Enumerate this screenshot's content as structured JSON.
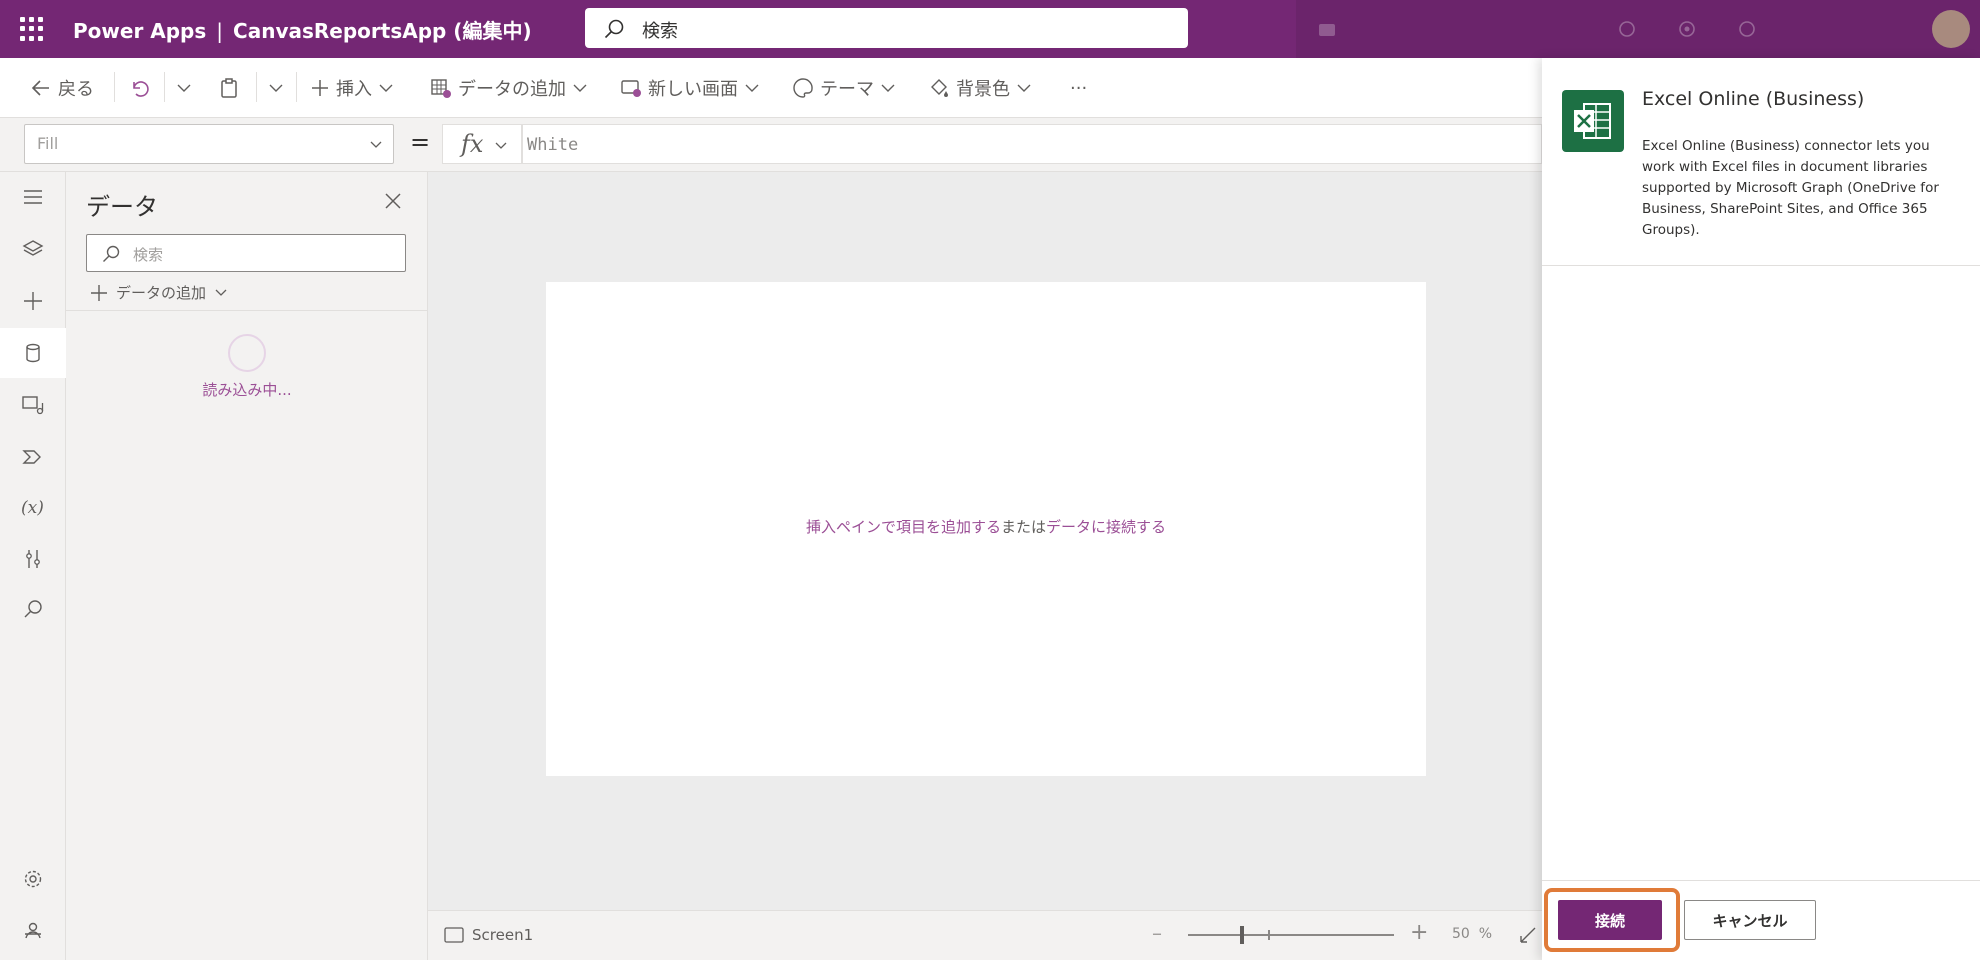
{
  "app": {
    "name": "Power Apps",
    "separator": "|",
    "doc_title": "CanvasReportsApp (編集中)"
  },
  "top_search": {
    "placeholder": "検索"
  },
  "toolbar": {
    "back": "戻る",
    "insert": "挿入",
    "add_data": "データの追加",
    "new_screen": "新しい画面",
    "theme": "テーマ",
    "background": "背景色",
    "more": "···"
  },
  "formula": {
    "property": "Fill",
    "equals": "=",
    "fx": "fx",
    "value": "White"
  },
  "data_panel": {
    "title": "データ",
    "search_placeholder": "検索",
    "add_data": "データの追加",
    "loading": "読み込み中..."
  },
  "canvas": {
    "link1": "挿入ペインで項目を追加する",
    "middle": "または",
    "link2": "データに接続する"
  },
  "status": {
    "screen": "Screen1",
    "zoom_value": "50",
    "zoom_unit": "%"
  },
  "connector": {
    "name": "Excel Online (Business)",
    "description": "Excel Online (Business) connector lets you work with Excel files in document libraries supported by Microsoft Graph (OneDrive for Business, SharePoint Sites, and Office 365 Groups).",
    "connect": "接続",
    "cancel": "キャンセル"
  },
  "colors": {
    "brand": "#742774",
    "accent_link": "#9b4f96",
    "excel": "#1d7044",
    "highlight": "#e07b39"
  }
}
